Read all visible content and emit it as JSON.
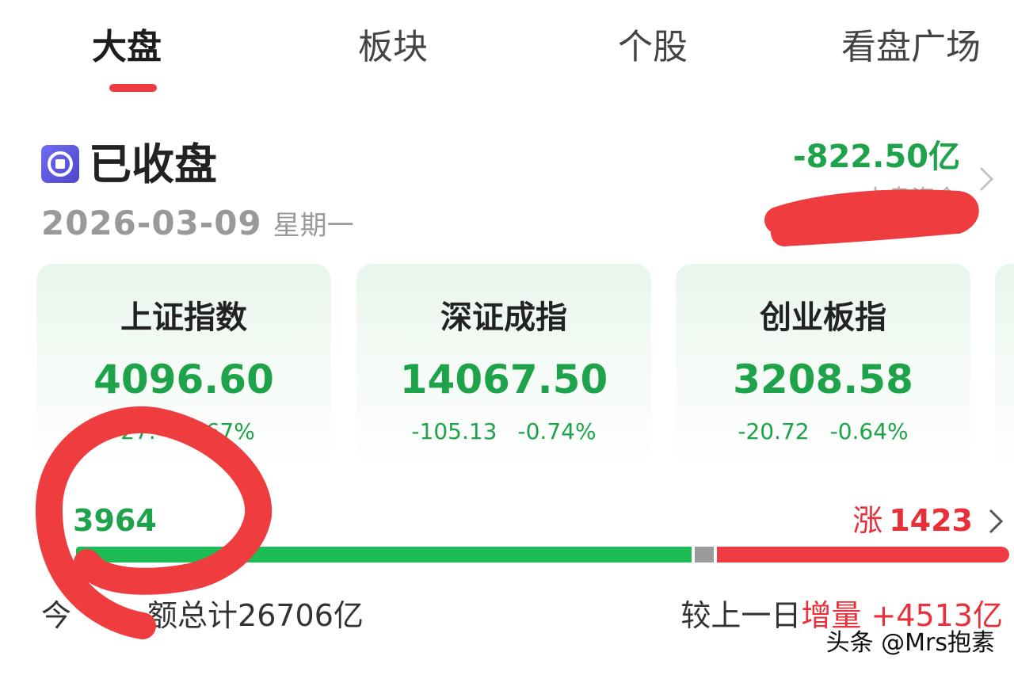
{
  "tabs": [
    {
      "label": "大盘",
      "active": true
    },
    {
      "label": "板块",
      "active": false
    },
    {
      "label": "个股",
      "active": false
    },
    {
      "label": "看盘广场",
      "active": false
    }
  ],
  "status": {
    "title": "已收盘",
    "date": "2026-03-09",
    "weekday": "星期一",
    "icon": "market-status-icon"
  },
  "capital_flow": {
    "value": "-822.50亿",
    "label": "大盘资金",
    "arrow_icon": "chevron-right-icon"
  },
  "indices": [
    {
      "name": "上证指数",
      "value": "4096.60",
      "change": "-27.",
      "change_pct": "-0.67%"
    },
    {
      "name": "深证成指",
      "value": "14067.50",
      "change": "-105.13",
      "change_pct": "-0.74%"
    },
    {
      "name": "创业板指",
      "value": "3208.58",
      "change": "-20.72",
      "change_pct": "-0.64%"
    }
  ],
  "breadth": {
    "fall_count": "3964",
    "rise_label": "涨",
    "rise_count": "1423",
    "fall_share": 0.66,
    "flat_share": 0.02,
    "rise_share": 0.32
  },
  "turnover": {
    "prefix": "今",
    "text": "额总计26706亿",
    "compare_label": "较上一日",
    "change_label": "增量",
    "change_value": "+4513亿"
  },
  "watermark": "头条 @Mrs抱素",
  "colors": {
    "down": "#1fa34a",
    "up": "#e8303a",
    "accent": "#ef3b43",
    "status_icon": "#5b57e0"
  }
}
